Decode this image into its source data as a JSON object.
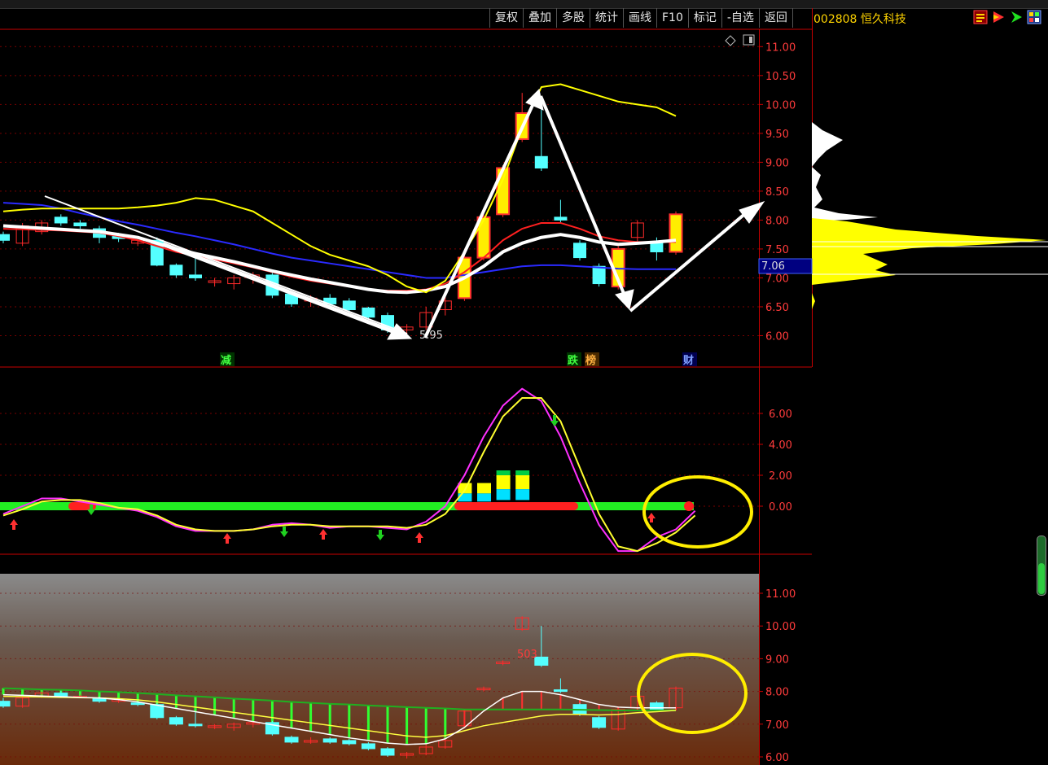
{
  "toolbar": {
    "items": [
      "复权",
      "叠加",
      "多股",
      "统计",
      "画线",
      "F10",
      "标记",
      "-自选",
      "返回"
    ]
  },
  "stock": {
    "code": "002808",
    "name": "恒久科技"
  },
  "icons": [
    "menu-icon",
    "play-red-icon",
    "arrow-green-icon",
    "grid-icon"
  ],
  "price_label": "7.06",
  "low_label": "5.95",
  "signals": {
    "jian": "减",
    "die": "跌",
    "bang": "榜",
    "cai": "财"
  },
  "bottom_label": "503",
  "colors": {
    "up": "#ff2a2a",
    "down": "#54ffff",
    "ma5": "#ffffff",
    "ma10": "#ffff00",
    "ma20": "#ff2020",
    "ma60": "#2020ff",
    "axis": "#c80000"
  },
  "chart_data": [
    {
      "type": "candlestick",
      "panel": "price",
      "y_ticks": [
        "11.00",
        "10.50",
        "10.00",
        "9.50",
        "9.00",
        "8.50",
        "8.00",
        "7.50",
        "7.00",
        "6.50",
        "6.00"
      ],
      "ylim": [
        5.7,
        11.5
      ],
      "x_count": 36,
      "candles": [
        [
          0,
          7.75,
          7.65,
          7.8,
          7.6
        ],
        [
          1,
          7.6,
          7.9,
          7.95,
          7.55
        ],
        [
          2,
          7.8,
          7.95,
          8.0,
          7.75
        ],
        [
          3,
          8.05,
          7.95,
          8.1,
          7.9
        ],
        [
          4,
          7.95,
          7.9,
          8.0,
          7.85
        ],
        [
          5,
          7.85,
          7.7,
          7.9,
          7.6
        ],
        [
          6,
          7.72,
          7.68,
          7.78,
          7.62
        ],
        [
          7,
          7.6,
          7.65,
          7.7,
          7.55
        ],
        [
          8,
          7.65,
          7.22,
          7.7,
          7.2
        ],
        [
          9,
          7.22,
          7.05,
          7.25,
          7.0
        ],
        [
          10,
          7.05,
          7.0,
          7.45,
          6.95
        ],
        [
          11,
          6.92,
          6.95,
          7.0,
          6.85
        ],
        [
          12,
          6.9,
          7.0,
          7.05,
          6.8
        ],
        [
          13,
          7.0,
          7.05,
          7.1,
          6.9
        ],
        [
          14,
          7.05,
          6.7,
          7.1,
          6.65
        ],
        [
          15,
          6.72,
          6.55,
          6.75,
          6.5
        ],
        [
          16,
          6.6,
          6.65,
          6.7,
          6.5
        ],
        [
          17,
          6.65,
          6.55,
          6.72,
          6.5
        ],
        [
          18,
          6.6,
          6.45,
          6.65,
          6.4
        ],
        [
          19,
          6.48,
          6.32,
          6.5,
          6.3
        ],
        [
          20,
          6.35,
          6.1,
          6.4,
          6.05
        ],
        [
          21,
          6.1,
          6.15,
          6.2,
          5.95
        ],
        [
          22,
          6.15,
          6.4,
          6.5,
          6.1
        ],
        [
          23,
          6.45,
          6.6,
          6.75,
          6.35
        ],
        [
          24,
          6.65,
          7.35,
          7.4,
          6.6
        ],
        [
          25,
          7.35,
          8.05,
          8.1,
          7.3
        ],
        [
          26,
          8.1,
          8.9,
          8.95,
          8.05
        ],
        [
          27,
          9.4,
          9.85,
          10.2,
          9.35
        ],
        [
          28,
          9.1,
          8.9,
          10.0,
          8.85
        ],
        [
          29,
          8.05,
          8.0,
          8.35,
          7.95
        ],
        [
          30,
          7.6,
          7.35,
          7.65,
          7.3
        ],
        [
          31,
          7.2,
          6.9,
          7.25,
          6.85
        ],
        [
          32,
          6.85,
          7.5,
          7.55,
          6.8
        ],
        [
          33,
          7.7,
          7.95,
          8.0,
          7.6
        ],
        [
          34,
          7.6,
          7.45,
          7.7,
          7.3
        ],
        [
          35,
          7.45,
          8.1,
          8.15,
          7.4
        ]
      ],
      "ma_white": [
        7.9,
        7.88,
        7.86,
        7.84,
        7.82,
        7.8,
        7.75,
        7.7,
        7.6,
        7.5,
        7.42,
        7.35,
        7.28,
        7.2,
        7.12,
        7.05,
        6.98,
        6.92,
        6.86,
        6.8,
        6.76,
        6.75,
        6.78,
        6.85,
        7.0,
        7.2,
        7.45,
        7.6,
        7.7,
        7.75,
        7.7,
        7.62,
        7.58,
        7.6,
        7.62,
        7.65
      ],
      "ma_yellow": [
        8.15,
        8.18,
        8.2,
        8.2,
        8.2,
        8.2,
        8.2,
        8.22,
        8.25,
        8.3,
        8.38,
        8.35,
        8.25,
        8.15,
        7.95,
        7.75,
        7.55,
        7.4,
        7.3,
        7.2,
        7.05,
        6.85,
        6.75,
        6.95,
        7.45,
        8.0,
        8.7,
        9.6,
        10.3,
        10.35,
        10.25,
        10.15,
        10.05,
        10.0,
        9.95,
        9.8
      ],
      "ma_red": [
        7.85,
        7.84,
        7.83,
        7.82,
        7.8,
        7.78,
        7.72,
        7.65,
        7.55,
        7.45,
        7.38,
        7.32,
        7.25,
        7.18,
        7.1,
        7.02,
        6.95,
        6.9,
        6.85,
        6.8,
        6.78,
        6.78,
        6.8,
        6.9,
        7.1,
        7.35,
        7.65,
        7.85,
        7.95,
        7.95,
        7.85,
        7.72,
        7.65,
        7.62,
        7.62,
        7.62
      ],
      "ma_blue": [
        8.3,
        8.28,
        8.26,
        8.2,
        8.12,
        8.05,
        7.98,
        7.92,
        7.85,
        7.78,
        7.72,
        7.65,
        7.58,
        7.5,
        7.42,
        7.35,
        7.3,
        7.25,
        7.2,
        7.15,
        7.1,
        7.05,
        7.0,
        7.0,
        7.05,
        7.1,
        7.15,
        7.2,
        7.22,
        7.22,
        7.2,
        7.18,
        7.16,
        7.15,
        7.15,
        7.15
      ],
      "current_price": 7.06,
      "low": 5.95
    },
    {
      "type": "line",
      "panel": "indicator",
      "y_ticks": [
        "6.00",
        "4.00",
        "2.00",
        "0.00"
      ],
      "ylim": [
        -3.0,
        8.0
      ],
      "magenta": [
        -0.5,
        0.0,
        0.5,
        0.5,
        0.3,
        0.1,
        -0.1,
        -0.3,
        -0.7,
        -1.3,
        -1.6,
        -1.6,
        -1.6,
        -1.5,
        -1.2,
        -1.1,
        -1.2,
        -1.4,
        -1.3,
        -1.3,
        -1.4,
        -1.5,
        -1.0,
        0.0,
        2.0,
        4.5,
        6.5,
        7.6,
        6.8,
        4.5,
        1.5,
        -1.2,
        -2.9,
        -2.9,
        -2.0,
        -1.5,
        -0.3
      ],
      "yellow": [
        -0.6,
        -0.2,
        0.3,
        0.4,
        0.4,
        0.2,
        -0.1,
        -0.2,
        -0.6,
        -1.2,
        -1.5,
        -1.6,
        -1.6,
        -1.5,
        -1.3,
        -1.2,
        -1.2,
        -1.3,
        -1.3,
        -1.3,
        -1.3,
        -1.4,
        -1.2,
        -0.5,
        1.0,
        3.5,
        5.8,
        7.0,
        7.0,
        5.5,
        2.5,
        -0.5,
        -2.6,
        -2.9,
        -2.4,
        -1.7,
        -0.6
      ],
      "bars_zero_to": [
        0,
        0,
        0,
        0,
        0,
        0,
        0,
        0,
        0,
        0,
        0,
        0,
        0,
        0,
        0,
        0,
        0,
        0,
        0,
        0,
        0,
        0,
        0,
        0,
        1.5,
        1.5,
        2.0,
        2.0,
        0,
        0,
        0,
        0,
        0,
        0,
        0,
        0
      ]
    },
    {
      "type": "candlestick",
      "panel": "bottom",
      "y_ticks": [
        "11.00",
        "10.00",
        "9.00",
        "8.00",
        "7.00",
        "6.00"
      ],
      "ylim": [
        5.8,
        11.6
      ],
      "candles": [
        [
          0,
          7.7,
          7.55,
          7.8,
          7.5
        ],
        [
          1,
          7.55,
          7.8,
          7.85,
          7.5
        ],
        [
          2,
          7.85,
          7.95,
          8.0,
          7.8
        ],
        [
          3,
          7.95,
          7.85,
          8.05,
          7.8
        ],
        [
          4,
          7.85,
          7.85,
          7.9,
          7.8
        ],
        [
          5,
          7.8,
          7.7,
          7.85,
          7.65
        ],
        [
          6,
          7.7,
          7.75,
          7.8,
          7.65
        ],
        [
          7,
          7.65,
          7.6,
          7.7,
          7.55
        ],
        [
          8,
          7.6,
          7.2,
          7.65,
          7.15
        ],
        [
          9,
          7.2,
          7.0,
          7.25,
          6.95
        ],
        [
          10,
          7.0,
          6.95,
          7.4,
          6.9
        ],
        [
          11,
          6.9,
          6.95,
          7.0,
          6.85
        ],
        [
          12,
          6.9,
          7.0,
          7.05,
          6.8
        ],
        [
          13,
          7.0,
          7.05,
          7.1,
          6.9
        ],
        [
          14,
          7.05,
          6.7,
          7.1,
          6.65
        ],
        [
          15,
          6.6,
          6.45,
          6.65,
          6.4
        ],
        [
          16,
          6.45,
          6.5,
          6.6,
          6.4
        ],
        [
          17,
          6.55,
          6.45,
          6.6,
          6.4
        ],
        [
          18,
          6.5,
          6.4,
          6.55,
          6.35
        ],
        [
          19,
          6.4,
          6.25,
          6.45,
          6.2
        ],
        [
          20,
          6.25,
          6.05,
          6.3,
          6.0
        ],
        [
          21,
          6.05,
          6.1,
          6.15,
          5.95
        ],
        [
          22,
          6.1,
          6.3,
          6.4,
          6.05
        ],
        [
          23,
          6.3,
          6.5,
          6.6,
          6.25
        ],
        [
          24,
          6.95,
          7.4,
          7.45,
          6.9
        ],
        [
          25,
          8.05,
          8.1,
          8.15,
          8.0
        ],
        [
          26,
          8.85,
          8.9,
          8.95,
          8.8
        ],
        [
          27,
          9.9,
          10.25,
          10.3,
          9.85
        ],
        [
          28,
          9.05,
          8.8,
          10.0,
          8.75
        ],
        [
          29,
          8.05,
          8.0,
          8.4,
          7.95
        ],
        [
          30,
          7.6,
          7.3,
          7.65,
          7.25
        ],
        [
          31,
          7.2,
          6.9,
          7.25,
          6.85
        ],
        [
          32,
          6.85,
          7.45,
          7.5,
          6.8
        ],
        [
          33,
          7.5,
          7.85,
          7.9,
          7.45
        ],
        [
          34,
          7.65,
          7.45,
          7.7,
          7.4
        ],
        [
          35,
          7.5,
          8.1,
          8.15,
          7.45
        ]
      ],
      "line_green": [
        8.1,
        8.08,
        8.06,
        8.05,
        8.03,
        8.0,
        7.98,
        7.95,
        7.92,
        7.88,
        7.85,
        7.82,
        7.78,
        7.75,
        7.72,
        7.68,
        7.65,
        7.62,
        7.6,
        7.57,
        7.55,
        7.52,
        7.5,
        7.48,
        7.45,
        7.45,
        7.45,
        7.45,
        7.45,
        7.45,
        7.44,
        7.43,
        7.42,
        7.42,
        7.42,
        7.42
      ],
      "line_white": [
        7.9,
        7.88,
        7.86,
        7.84,
        7.82,
        7.8,
        7.75,
        7.68,
        7.58,
        7.48,
        7.38,
        7.28,
        7.18,
        7.08,
        6.98,
        6.88,
        6.78,
        6.68,
        6.58,
        6.5,
        6.42,
        6.38,
        6.4,
        6.55,
        6.9,
        7.4,
        7.8,
        8.0,
        8.0,
        7.9,
        7.75,
        7.6,
        7.52,
        7.5,
        7.5,
        7.5
      ],
      "line_yellow": [
        7.85,
        7.84,
        7.83,
        7.82,
        7.81,
        7.8,
        7.78,
        7.74,
        7.68,
        7.6,
        7.52,
        7.44,
        7.36,
        7.28,
        7.2,
        7.12,
        7.04,
        6.96,
        6.88,
        6.8,
        6.72,
        6.64,
        6.6,
        6.65,
        6.8,
        6.95,
        7.05,
        7.15,
        7.25,
        7.3,
        7.3,
        7.28,
        7.3,
        7.35,
        7.38,
        7.42
      ]
    }
  ]
}
